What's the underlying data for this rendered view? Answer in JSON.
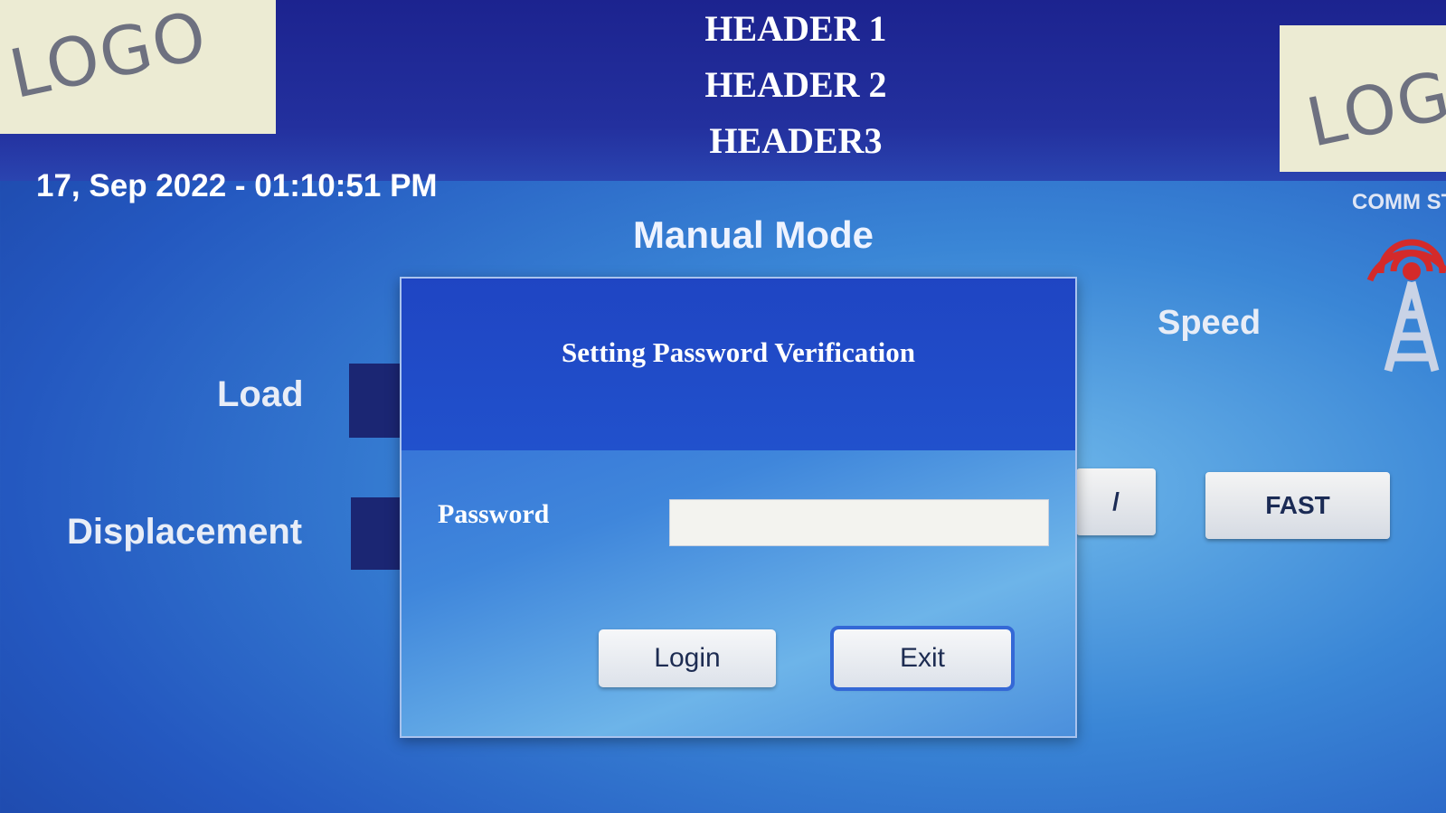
{
  "header": {
    "logo_left": "LOGO",
    "logo_right": "LOG",
    "lines": [
      "HEADER 1",
      "HEADER 2",
      "HEADER3"
    ]
  },
  "status": {
    "datetime": "17, Sep 2022  - 01:10:51 PM",
    "mode": "Manual Mode",
    "comm_status": "COMM ST"
  },
  "fields": {
    "load_label": "Load",
    "displacement_label": "Displacement",
    "speed_label": "Speed"
  },
  "speed_buttons": {
    "partial_label": "/",
    "fast_label": "FAST"
  },
  "dialog": {
    "title": "Setting Password Verification",
    "password_label": "Password",
    "password_value": "",
    "login_label": "Login",
    "exit_label": "Exit"
  },
  "colors": {
    "header_bg": "#1c238f",
    "dialog_header": "#1f45c3",
    "field_box": "#1b2673",
    "comm_icon": "#d42a2a"
  }
}
